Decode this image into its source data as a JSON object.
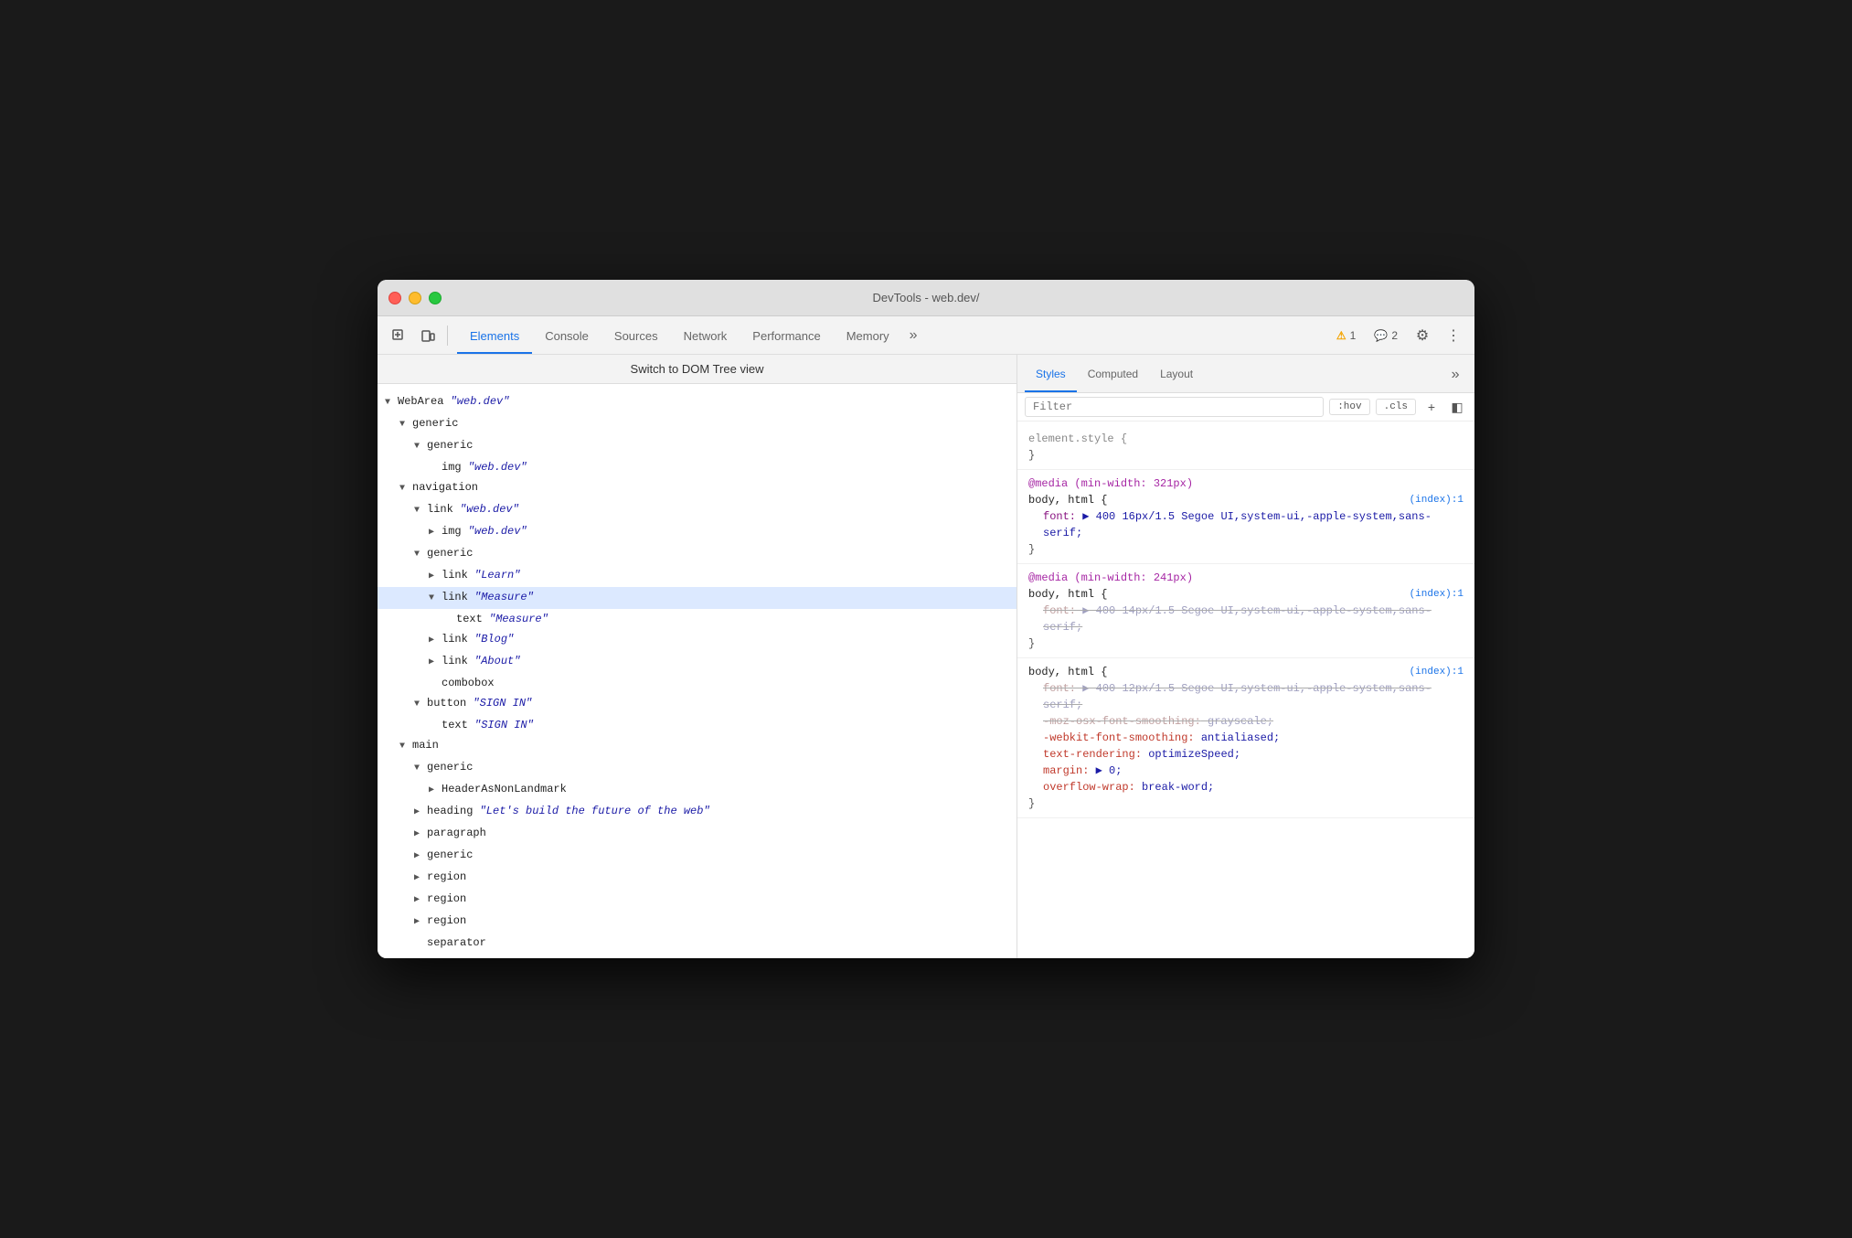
{
  "window": {
    "title": "DevTools - web.dev/"
  },
  "toolbar": {
    "tabs": [
      {
        "id": "elements",
        "label": "Elements",
        "active": true
      },
      {
        "id": "console",
        "label": "Console",
        "active": false
      },
      {
        "id": "sources",
        "label": "Sources",
        "active": false
      },
      {
        "id": "network",
        "label": "Network",
        "active": false
      },
      {
        "id": "performance",
        "label": "Performance",
        "active": false
      },
      {
        "id": "memory",
        "label": "Memory",
        "active": false
      }
    ],
    "more_tabs_icon": "»",
    "warnings": "1",
    "messages": "2",
    "settings_icon": "⚙",
    "more_icon": "⋮",
    "inspect_icon": "⬚",
    "device_icon": "▣"
  },
  "dom_panel": {
    "switch_btn": "Switch to DOM Tree view",
    "tree": [
      {
        "indent": 0,
        "expand": "open",
        "text": "WebArea ",
        "italic": "\"web.dev\"",
        "type": "node"
      },
      {
        "indent": 1,
        "expand": "open",
        "text": "generic",
        "type": "node"
      },
      {
        "indent": 2,
        "expand": "open",
        "text": "generic",
        "type": "node"
      },
      {
        "indent": 3,
        "expand": "leaf",
        "text": "img ",
        "italic": "\"web.dev\"",
        "type": "node"
      },
      {
        "indent": 1,
        "expand": "open",
        "text": "navigation",
        "type": "node"
      },
      {
        "indent": 2,
        "expand": "open",
        "text": "link ",
        "italic": "\"web.dev\"",
        "type": "node"
      },
      {
        "indent": 3,
        "expand": "closed",
        "text": "img ",
        "italic": "\"web.dev\"",
        "type": "node"
      },
      {
        "indent": 2,
        "expand": "open",
        "text": "generic",
        "type": "node"
      },
      {
        "indent": 3,
        "expand": "closed",
        "text": "link ",
        "italic": "\"Learn\"",
        "type": "node"
      },
      {
        "indent": 3,
        "expand": "open",
        "text": "link ",
        "italic": "\"Measure\"",
        "type": "node",
        "selected": true
      },
      {
        "indent": 4,
        "expand": "leaf",
        "text": "text ",
        "italic": "\"Measure\"",
        "type": "node"
      },
      {
        "indent": 3,
        "expand": "closed",
        "text": "link ",
        "italic": "\"Blog\"",
        "type": "node"
      },
      {
        "indent": 3,
        "expand": "closed",
        "text": "link ",
        "italic": "\"About\"",
        "type": "node"
      },
      {
        "indent": 3,
        "expand": "leaf",
        "text": "combobox",
        "type": "node"
      },
      {
        "indent": 2,
        "expand": "open",
        "text": "button ",
        "italic": "\"SIGN IN\"",
        "type": "node"
      },
      {
        "indent": 3,
        "expand": "leaf",
        "text": "text ",
        "italic": "\"SIGN IN\"",
        "type": "node"
      },
      {
        "indent": 1,
        "expand": "open",
        "text": "main",
        "type": "node"
      },
      {
        "indent": 2,
        "expand": "open",
        "text": "generic",
        "type": "node"
      },
      {
        "indent": 3,
        "expand": "closed",
        "text": "HeaderAsNonLandmark",
        "type": "node"
      },
      {
        "indent": 2,
        "expand": "closed",
        "text": "heading ",
        "italic": "\"Let's build the future of the web\"",
        "type": "node"
      },
      {
        "indent": 2,
        "expand": "closed",
        "text": "paragraph",
        "type": "node"
      },
      {
        "indent": 2,
        "expand": "closed",
        "text": "generic",
        "type": "node"
      },
      {
        "indent": 2,
        "expand": "closed",
        "text": "region",
        "type": "node"
      },
      {
        "indent": 2,
        "expand": "closed",
        "text": "region",
        "type": "node"
      },
      {
        "indent": 2,
        "expand": "closed",
        "text": "region",
        "type": "node"
      },
      {
        "indent": 2,
        "expand": "leaf",
        "text": "separator",
        "type": "node"
      }
    ]
  },
  "styles_panel": {
    "tabs": [
      {
        "id": "styles",
        "label": "Styles",
        "active": true
      },
      {
        "id": "computed",
        "label": "Computed",
        "active": false
      },
      {
        "id": "layout",
        "label": "Layout",
        "active": false
      }
    ],
    "filter_placeholder": "Filter",
    "filter_btn1": ":hov",
    "filter_btn2": ".cls",
    "rules": [
      {
        "type": "element",
        "selector": "element.style {",
        "close": "}",
        "properties": []
      },
      {
        "type": "media",
        "media_query": "@media (min-width: 321px)",
        "selector": "body, html {",
        "source": "(index):1",
        "close": "}",
        "properties": [
          {
            "name": "font:",
            "value": "▶ 400 16px/1.5 Segoe UI,system-ui,-apple-system,sans-serif;",
            "strikethrough": false,
            "red": false
          }
        ]
      },
      {
        "type": "media",
        "media_query": "@media (min-width: 241px)",
        "selector": "body, html {",
        "source": "(index):1",
        "close": "}",
        "properties": [
          {
            "name": "font:",
            "value": "▶ 400 14px/1.5 Segoe UI,system-ui,-apple-system,sans-serif;",
            "strikethrough": true,
            "red": false
          }
        ]
      },
      {
        "type": "rule",
        "selector": "body, html {",
        "source": "(index):1",
        "close": "}",
        "properties": [
          {
            "name": "font:",
            "value": "▶ 400 12px/1.5 Segoe UI,system-ui,-apple-system,sans-serif;",
            "strikethrough": true,
            "red": false
          },
          {
            "name": "-moz-osx-font-smoothing:",
            "value": "grayscale;",
            "strikethrough": true,
            "red": false
          },
          {
            "name": "-webkit-font-smoothing:",
            "value": "antialiased;",
            "strikethrough": false,
            "red": true
          },
          {
            "name": "text-rendering:",
            "value": "optimizeSpeed;",
            "strikethrough": false,
            "red": true
          },
          {
            "name": "margin:",
            "value": "▶ 0;",
            "strikethrough": false,
            "red": true
          },
          {
            "name": "overflow-wrap:",
            "value": "break-word;",
            "strikethrough": false,
            "red": true,
            "partial": true
          }
        ]
      }
    ]
  }
}
